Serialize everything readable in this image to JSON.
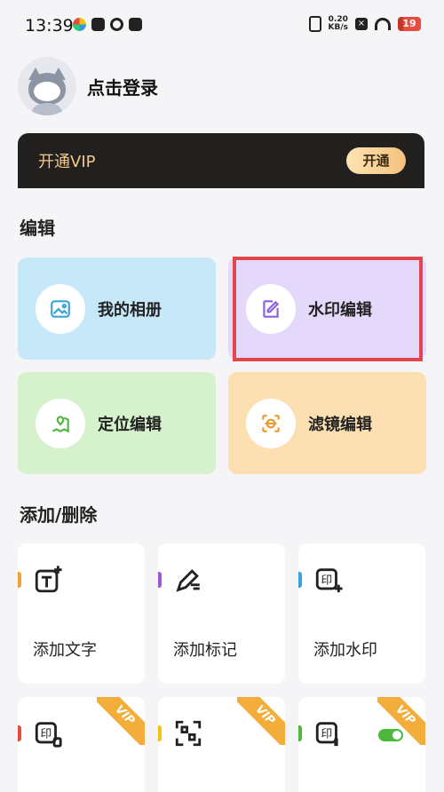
{
  "status_bar": {
    "time": "13:39",
    "net_speed_value": "0.20",
    "net_speed_unit": "KB/s",
    "battery": "19"
  },
  "profile": {
    "login_text": "点击登录"
  },
  "vip": {
    "text": "开通VIP",
    "button": "开通"
  },
  "sections": {
    "edit": "编辑",
    "add_delete": "添加/删除"
  },
  "edit_cards": [
    {
      "label": "我的相册",
      "icon": "image-icon",
      "bg": "#c6e8f8",
      "icon_color": "#3aa3d8"
    },
    {
      "label": "水印编辑",
      "icon": "edit-note-icon",
      "bg": "#e4d9fb",
      "icon_color": "#8a5fe0"
    },
    {
      "label": "定位编辑",
      "icon": "map-pin-icon",
      "bg": "#d6f2cc",
      "icon_color": "#4fb83c"
    },
    {
      "label": "滤镜编辑",
      "icon": "scan-face-icon",
      "bg": "#fde0b1",
      "icon_color": "#eb9a2e"
    }
  ],
  "tools": [
    {
      "label": "添加文字",
      "icon": "add-text-icon",
      "accent": "#f0a23a"
    },
    {
      "label": "添加标记",
      "icon": "add-mark-icon",
      "accent": "#9b59d0"
    },
    {
      "label": "添加水印",
      "icon": "add-watermark-icon",
      "accent": "#3aa3d8"
    }
  ],
  "vip_tools": [
    {
      "icon": "delete-watermark-icon",
      "accent": "#e74c3c",
      "badge": "VIP"
    },
    {
      "icon": "qr-code-icon",
      "accent": "#f1c40f",
      "badge": "VIP"
    },
    {
      "icon": "watermark-toggle-icon",
      "accent": "#4fb83c",
      "badge": "VIP"
    }
  ]
}
